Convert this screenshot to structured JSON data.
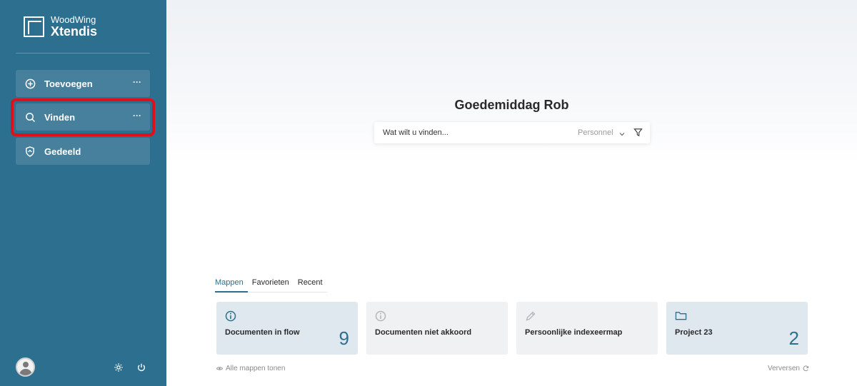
{
  "brand": {
    "company": "WoodWing",
    "product": "Xtendis"
  },
  "sidebar": {
    "items": [
      {
        "label": "Toevoegen",
        "icon": "plus-circle-icon",
        "more": "···"
      },
      {
        "label": "Vinden",
        "icon": "search-icon",
        "more": "···",
        "highlighted": true
      },
      {
        "label": "Gedeeld",
        "icon": "shield-icon"
      }
    ],
    "footer": {
      "avatar": "avatar",
      "settings_icon": "gear-icon",
      "power_icon": "power-icon"
    }
  },
  "main": {
    "greeting": "Goedemiddag Rob",
    "search": {
      "placeholder": "Wat wilt u vinden...",
      "scope": "Personnel"
    },
    "tabs": [
      {
        "label": "Mappen",
        "active": true
      },
      {
        "label": "Favorieten",
        "active": false
      },
      {
        "label": "Recent",
        "active": false
      }
    ],
    "cards": [
      {
        "title": "Documenten in flow",
        "count": "9",
        "icon": "info-icon"
      },
      {
        "title": "Documenten niet akkoord",
        "count": "",
        "icon": "info-icon"
      },
      {
        "title": "Persoonlijke indexeermap",
        "count": "",
        "icon": "pencil-icon"
      },
      {
        "title": "Project 23",
        "count": "2",
        "icon": "folder-icon"
      }
    ],
    "show_all": "Alle mappen tonen",
    "refresh": "Verversen"
  },
  "colors": {
    "sidebar": "#2d6f8f",
    "accent": "#2d6f8f",
    "highlight": "#e0101a",
    "card_blue": "#dfe8ef",
    "card_gray": "#f0f1f3"
  }
}
